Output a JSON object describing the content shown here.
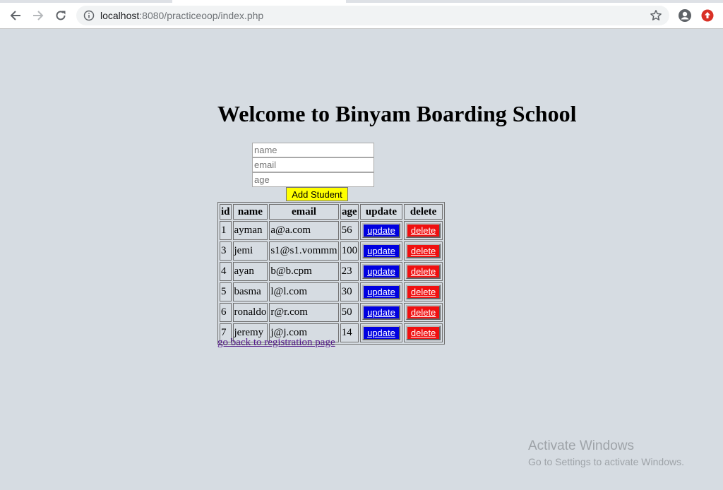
{
  "browser": {
    "url_host": "localhost",
    "url_rest": ":8080/practiceoop/index.php"
  },
  "page": {
    "heading": "Welcome to Binyam Boarding School",
    "form": {
      "name_placeholder": "name",
      "email_placeholder": "email",
      "age_placeholder": "age",
      "add_button_label": "Add Student"
    },
    "table": {
      "headers": [
        "id",
        "name",
        "email",
        "age",
        "update",
        "delete"
      ],
      "rows": [
        {
          "id": "1",
          "name": "ayman",
          "email": "a@a.com",
          "age": "56",
          "update": "update",
          "delete": "delete"
        },
        {
          "id": "3",
          "name": "jemi",
          "email": "s1@s1.vommm",
          "age": "100",
          "update": "update",
          "delete": "delete"
        },
        {
          "id": "4",
          "name": "ayan",
          "email": "b@b.cpm",
          "age": "23",
          "update": "update",
          "delete": "delete"
        },
        {
          "id": "5",
          "name": "basma",
          "email": "l@l.com",
          "age": "30",
          "update": "update",
          "delete": "delete"
        },
        {
          "id": "6",
          "name": "ronaldo",
          "email": "r@r.com",
          "age": "50",
          "update": "update",
          "delete": "delete"
        },
        {
          "id": "7",
          "name": "jeremy",
          "email": "j@j.com",
          "age": "14",
          "update": "update",
          "delete": "delete"
        }
      ]
    },
    "back_link": "go back to registration page"
  },
  "watermark": {
    "title": "Activate Windows",
    "subtitle": "Go to Settings to activate Windows."
  },
  "colors": {
    "page_background": "#d6dce2",
    "add_button": "#ffff00",
    "update_button": "#0000e0",
    "delete_button": "#f01010",
    "visited_link": "#551a8b"
  },
  "icons": [
    "back-arrow-icon",
    "forward-arrow-icon",
    "reload-icon",
    "info-icon",
    "star-icon",
    "profile-icon",
    "update-available-icon"
  ]
}
